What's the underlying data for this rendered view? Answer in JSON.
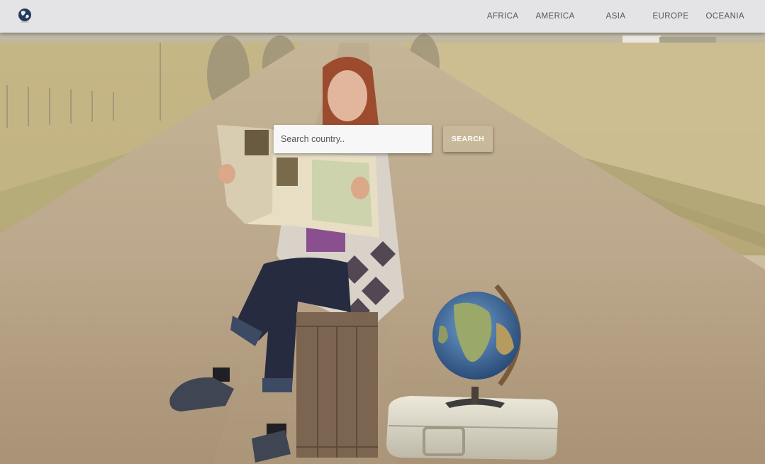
{
  "navbar": {
    "brand_icon": "globe-icon",
    "links": [
      "AFRICA",
      "AMERICA",
      "ASIA",
      "EUROPE",
      "OCEANIA"
    ]
  },
  "search": {
    "placeholder": "Search country..",
    "value": "",
    "button_label": "SEARCH"
  },
  "hero": {
    "image": "woman-reading-map-on-road-photo"
  },
  "colors": {
    "navbar_bg": "#e4e4e7",
    "nav_text": "#55565a",
    "button_bg": "#c7b999",
    "button_text": "#ffffff"
  }
}
